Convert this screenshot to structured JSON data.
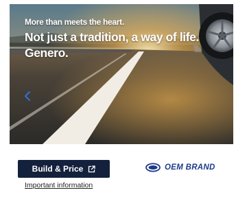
{
  "hero": {
    "tagline": "More than meets the heart.",
    "headline": "Not just a tradition, a way of life. Genero."
  },
  "icons": {
    "prev": "chevron-left-icon",
    "external": "external-link-icon",
    "brand": "oem-brand-logo"
  },
  "cta": {
    "label": "Build & Price"
  },
  "links": {
    "important_info": "Important information"
  },
  "brand": {
    "name": "OEM BRAND"
  },
  "colors": {
    "cta_background": "#14213d",
    "brand_blue": "#1d3a8a",
    "arrow_blue": "#2f6fd6"
  }
}
